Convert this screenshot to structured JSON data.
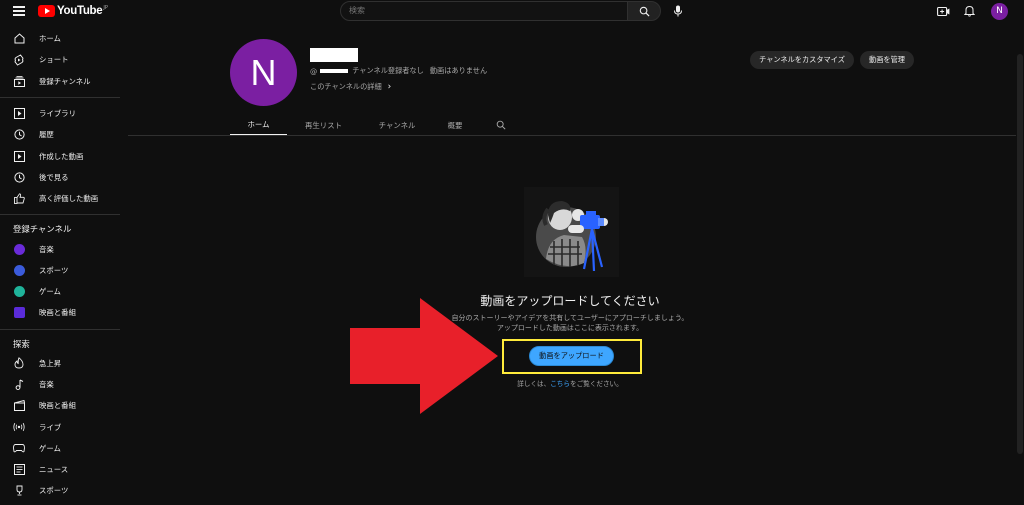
{
  "header": {
    "logo_text": "YouTube",
    "logo_region": "JP",
    "search_placeholder": "検索",
    "avatar_letter": "N"
  },
  "sidebar": {
    "main": [
      {
        "label": "ホーム",
        "icon": "home-icon"
      },
      {
        "label": "ショート",
        "icon": "shorts-icon"
      },
      {
        "label": "登録チャンネル",
        "icon": "subscriptions-icon"
      }
    ],
    "library": [
      {
        "label": "ライブラリ",
        "icon": "library-icon"
      },
      {
        "label": "履歴",
        "icon": "history-icon"
      },
      {
        "label": "作成した動画",
        "icon": "your-videos-icon"
      },
      {
        "label": "後で見る",
        "icon": "watch-later-icon"
      },
      {
        "label": "高く評価した動画",
        "icon": "liked-videos-icon"
      }
    ],
    "subscriptions_heading": "登録チャンネル",
    "subscriptions": [
      {
        "label": "音楽",
        "color": "#6a2bd9"
      },
      {
        "label": "スポーツ",
        "color": "#3b5bdb"
      },
      {
        "label": "ゲーム",
        "color": "#1fb39a"
      },
      {
        "label": "映画と番組",
        "color": "#5a2bd9"
      }
    ],
    "explore_heading": "探索",
    "explore": [
      {
        "label": "急上昇",
        "icon": "trending-icon"
      },
      {
        "label": "音楽",
        "icon": "music-icon"
      },
      {
        "label": "映画と番組",
        "icon": "movies-icon"
      },
      {
        "label": "ライブ",
        "icon": "live-icon"
      },
      {
        "label": "ゲーム",
        "icon": "gaming-icon"
      },
      {
        "label": "ニュース",
        "icon": "news-icon"
      },
      {
        "label": "スポーツ",
        "icon": "sports-icon"
      }
    ]
  },
  "channel": {
    "avatar_letter": "N",
    "handle_prefix": "@",
    "subscribers": "チャンネル登録者なし",
    "videos": "動画はありません",
    "details_link": "このチャンネルの詳細",
    "customize_button": "チャンネルをカスタマイズ",
    "manage_button": "動画を管理"
  },
  "tabs": [
    {
      "label": "ホーム",
      "active": true
    },
    {
      "label": "再生リスト",
      "active": false
    },
    {
      "label": "チャンネル",
      "active": false
    },
    {
      "label": "概要",
      "active": false
    }
  ],
  "empty_state": {
    "title": "動画をアップロードしてください",
    "desc_line1": "自分のストーリーやアイデアを共有してユーザーにアプローチしましょう。",
    "desc_line2": "アップロードした動画はここに表示されます。",
    "upload_button": "動画をアップロード",
    "learn_prefix": "詳しくは、",
    "learn_link": "こちら",
    "learn_suffix": "をご覧ください。"
  },
  "colors": {
    "accent": "#3ea6ff",
    "highlight": "#ffeb3b",
    "arrow": "#e8202a",
    "avatar": "#7b1fa2"
  }
}
